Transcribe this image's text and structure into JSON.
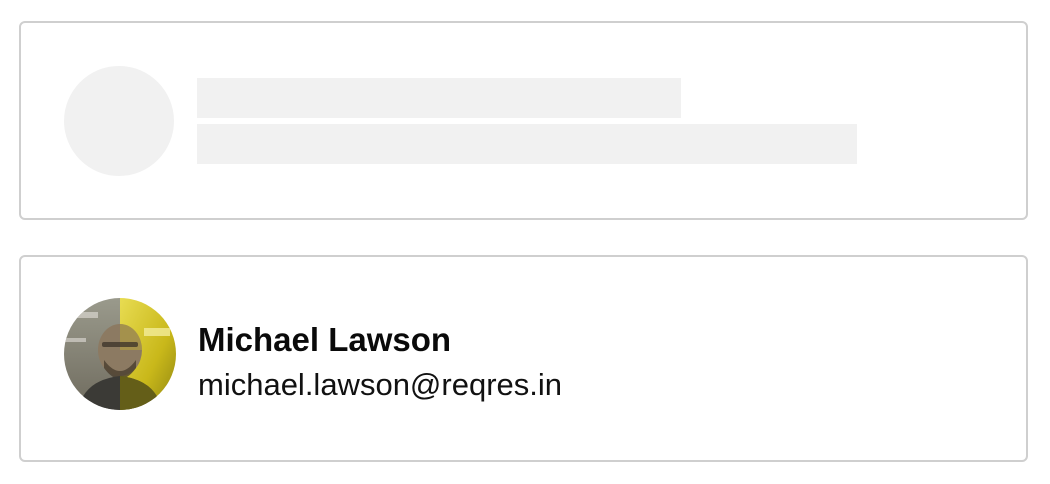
{
  "skeleton_card": {
    "state": "loading"
  },
  "user_card": {
    "name": "Michael Lawson",
    "email": "michael.lawson@reqres.in",
    "avatar_icon": "user-avatar-photo"
  },
  "colors": {
    "border": "#cfcfcf",
    "skeleton": "#f1f1f1",
    "text": "#0a0a0a",
    "avatar_tint": "#d7c520"
  }
}
